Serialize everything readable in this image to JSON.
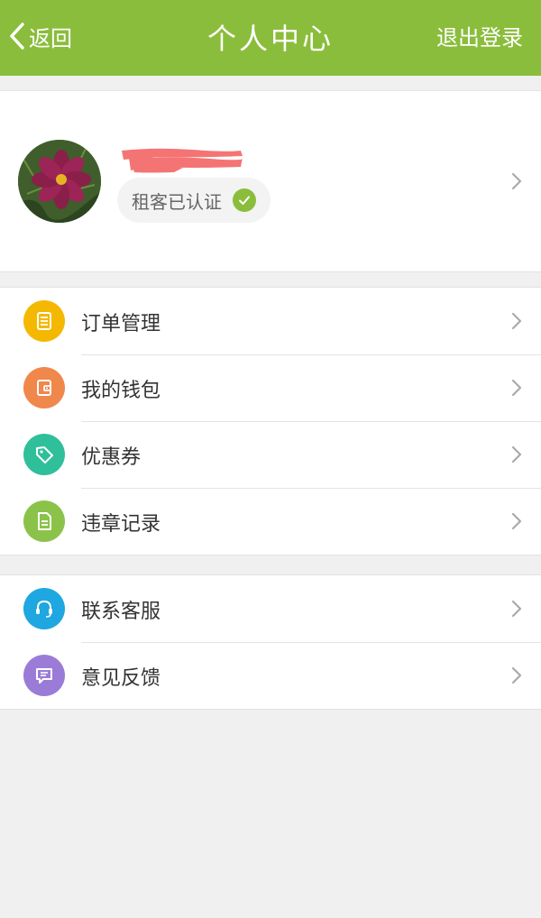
{
  "header": {
    "back_label": "返回",
    "title": "个人中心",
    "logout_label": "退出登录",
    "bar_color": "#8bbd3c"
  },
  "profile": {
    "verified_label": "租客已认证",
    "avatar": "flower-photo"
  },
  "menu_group_1": [
    {
      "label": "订单管理",
      "icon": "order-list-icon",
      "color": "#f5b800"
    },
    {
      "label": "我的钱包",
      "icon": "wallet-icon",
      "color": "#f0874b"
    },
    {
      "label": "优惠券",
      "icon": "coupon-tag-icon",
      "color": "#2fbf9b"
    },
    {
      "label": "违章记录",
      "icon": "document-icon",
      "color": "#8bc34a"
    }
  ],
  "menu_group_2": [
    {
      "label": "联系客服",
      "icon": "headset-icon",
      "color": "#1ea7e0"
    },
    {
      "label": "意见反馈",
      "icon": "message-icon",
      "color": "#9a7cd8"
    }
  ]
}
